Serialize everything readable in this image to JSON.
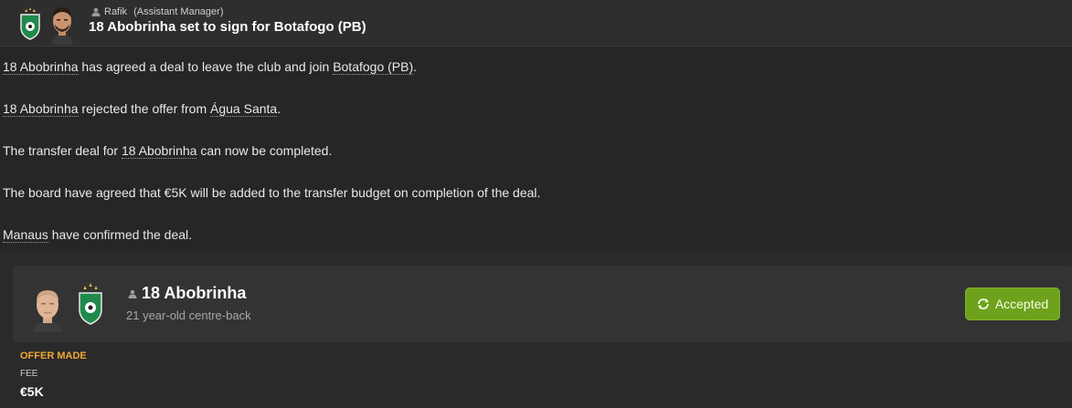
{
  "header": {
    "sender_name": "Rafik",
    "sender_role": "(Assistant Manager)",
    "subject": "18 Abobrinha set to sign for Botafogo (PB)"
  },
  "body": {
    "p1": {
      "player": "18 Abobrinha",
      "text": " has agreed a deal to leave the club and join ",
      "club": "Botafogo (PB)",
      "end": "."
    },
    "p2": {
      "player": "18 Abobrinha",
      "text": " rejected the offer from ",
      "club": "Água Santa",
      "end": "."
    },
    "p3": {
      "before": "The transfer deal for ",
      "player": "18 Abobrinha",
      "after": " can now be completed."
    },
    "p4": {
      "text": "The board have agreed that €5K will be added to the transfer budget on completion of the deal."
    },
    "p5": {
      "club": "Manaus",
      "text": " have confirmed the deal."
    }
  },
  "card": {
    "player_name": "18 Abobrinha",
    "description": "21 year-old centre-back",
    "status_label": "Accepted",
    "offer_label": "OFFER MADE",
    "fee_label": "FEE",
    "fee_value": "€5K"
  },
  "colors": {
    "accent_green": "#6fa21c",
    "offer_orange": "#f0a830",
    "background": "#262626",
    "crest_green": "#1f8a4c"
  },
  "icons": {
    "club_crest": "club-crest-icon",
    "person": "person-icon",
    "refresh": "refresh-icon"
  }
}
